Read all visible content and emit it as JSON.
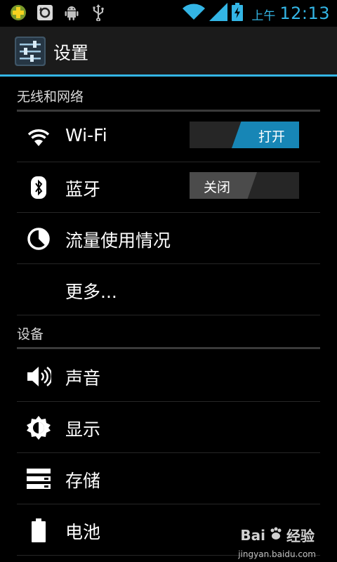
{
  "status_bar": {
    "notification_icons": [
      "cross-badge-icon",
      "sync-icon",
      "android-icon",
      "usb-icon"
    ],
    "right_icons": [
      "wifi-icon",
      "signal-icon",
      "battery-charging-icon"
    ],
    "ampm": "上午",
    "time": "12:13"
  },
  "action_bar": {
    "icon": "settings-sliders-icon",
    "title": "设置"
  },
  "sections": {
    "wireless": {
      "title": "无线和网络"
    },
    "device": {
      "title": "设备"
    }
  },
  "rows": {
    "wifi": {
      "label": "Wi-Fi",
      "icon": "wifi-icon",
      "toggle": "打开",
      "state": "on"
    },
    "bluetooth": {
      "label": "蓝牙",
      "icon": "bluetooth-icon",
      "toggle": "关闭",
      "state": "off"
    },
    "data_usage": {
      "label": "流量使用情况",
      "icon": "data-usage-icon"
    },
    "more": {
      "label": "更多..."
    },
    "sound": {
      "label": "声音",
      "icon": "speaker-icon"
    },
    "display": {
      "label": "显示",
      "icon": "brightness-icon"
    },
    "storage": {
      "label": "存储",
      "icon": "storage-icon"
    },
    "battery": {
      "label": "电池",
      "icon": "battery-icon"
    }
  },
  "watermark": {
    "brand": "Bai",
    "brand2": "经验",
    "url": "jingyan.baidu.com"
  },
  "colors": {
    "accent": "#33b5e5",
    "toggle_on": "#1786b6",
    "background": "#000000"
  }
}
